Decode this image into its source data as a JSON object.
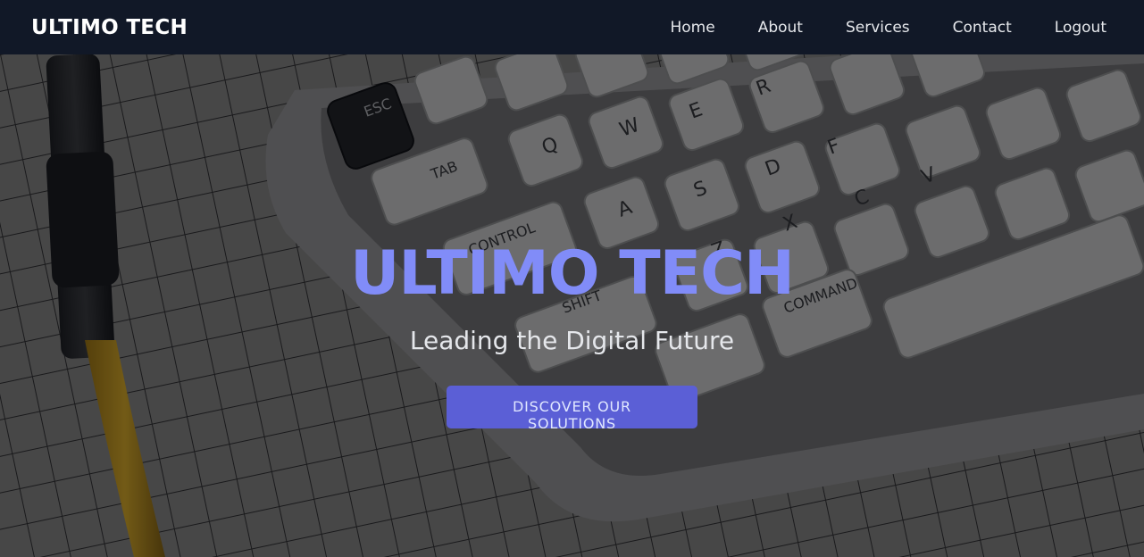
{
  "nav": {
    "brand": "ULTIMO TECH",
    "links": [
      {
        "label": "Home"
      },
      {
        "label": "About"
      },
      {
        "label": "Services"
      },
      {
        "label": "Contact"
      },
      {
        "label": "Logout"
      }
    ]
  },
  "hero": {
    "title": "ULTIMO TECH",
    "subtitle": "Leading the Digital Future",
    "cta_label": "DISCOVER OUR SOLUTIONS",
    "keycaps": [
      "ESC",
      "TAB",
      "CONTROL",
      "SHIFT",
      "COMMAND",
      "Q",
      "W",
      "E",
      "R",
      "A",
      "S",
      "D",
      "F",
      "Z",
      "X",
      "C",
      "V"
    ]
  },
  "colors": {
    "nav_bg": "#111827",
    "accent": "#818cf8",
    "button_bg": "#5b5fd6"
  }
}
